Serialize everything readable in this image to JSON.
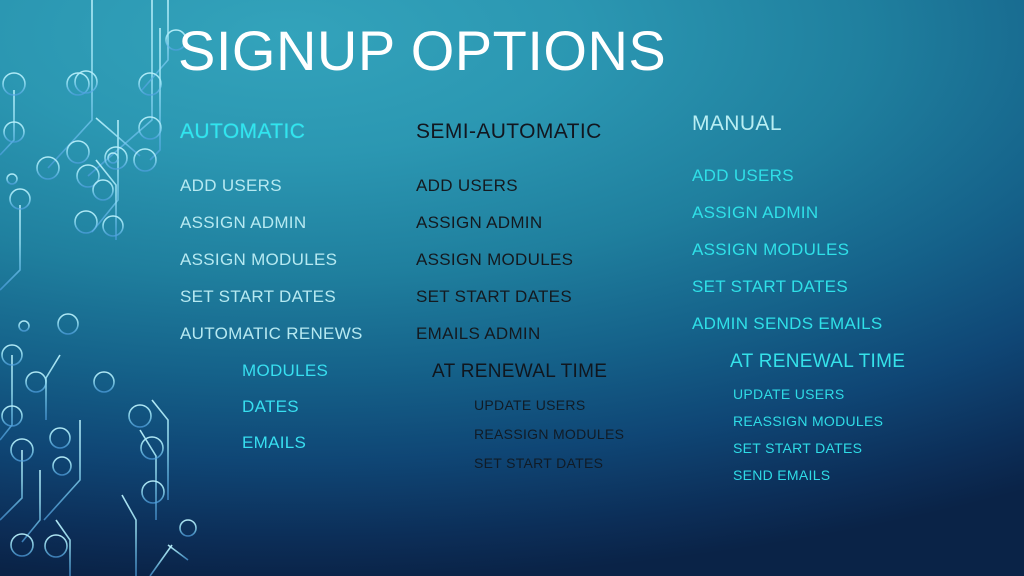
{
  "slide": {
    "title": "SIGNUP OPTIONS",
    "background": {
      "top_color": "#2b97b2",
      "bottom_color": "#0a2347",
      "decoration": "circuit-board-pattern"
    }
  },
  "columns": [
    {
      "id": "automatic",
      "heading": "AUTOMATIC",
      "heading_color": "#2fe6ef",
      "items": [
        "ADD USERS",
        "ASSIGN ADMIN",
        "ASSIGN MODULES",
        "SET START DATES",
        "AUTOMATIC RENEWS"
      ],
      "sub_heading": "",
      "sub_items": [
        "MODULES",
        "DATES",
        "EMAILS"
      ]
    },
    {
      "id": "semi-automatic",
      "heading": "SEMI-AUTOMATIC",
      "heading_color": "#12161f",
      "items": [
        "ADD USERS",
        "ASSIGN ADMIN",
        "ASSIGN MODULES",
        "SET START DATES",
        "EMAILS ADMIN"
      ],
      "sub_heading": "AT RENEWAL TIME",
      "sub_items": [
        "UPDATE USERS",
        "REASSIGN MODULES",
        "SET START DATES"
      ]
    },
    {
      "id": "manual",
      "heading": "MANUAL",
      "heading_color": "#b9eef3",
      "items": [
        "ADD USERS",
        "ASSIGN ADMIN",
        "ASSIGN MODULES",
        "SET START DATES",
        "ADMIN SENDS EMAILS"
      ],
      "sub_heading": "AT RENEWAL TIME",
      "sub_items": [
        "UPDATE USERS",
        "REASSIGN MODULES",
        "SET START DATES",
        "SEND EMAILS"
      ]
    }
  ]
}
